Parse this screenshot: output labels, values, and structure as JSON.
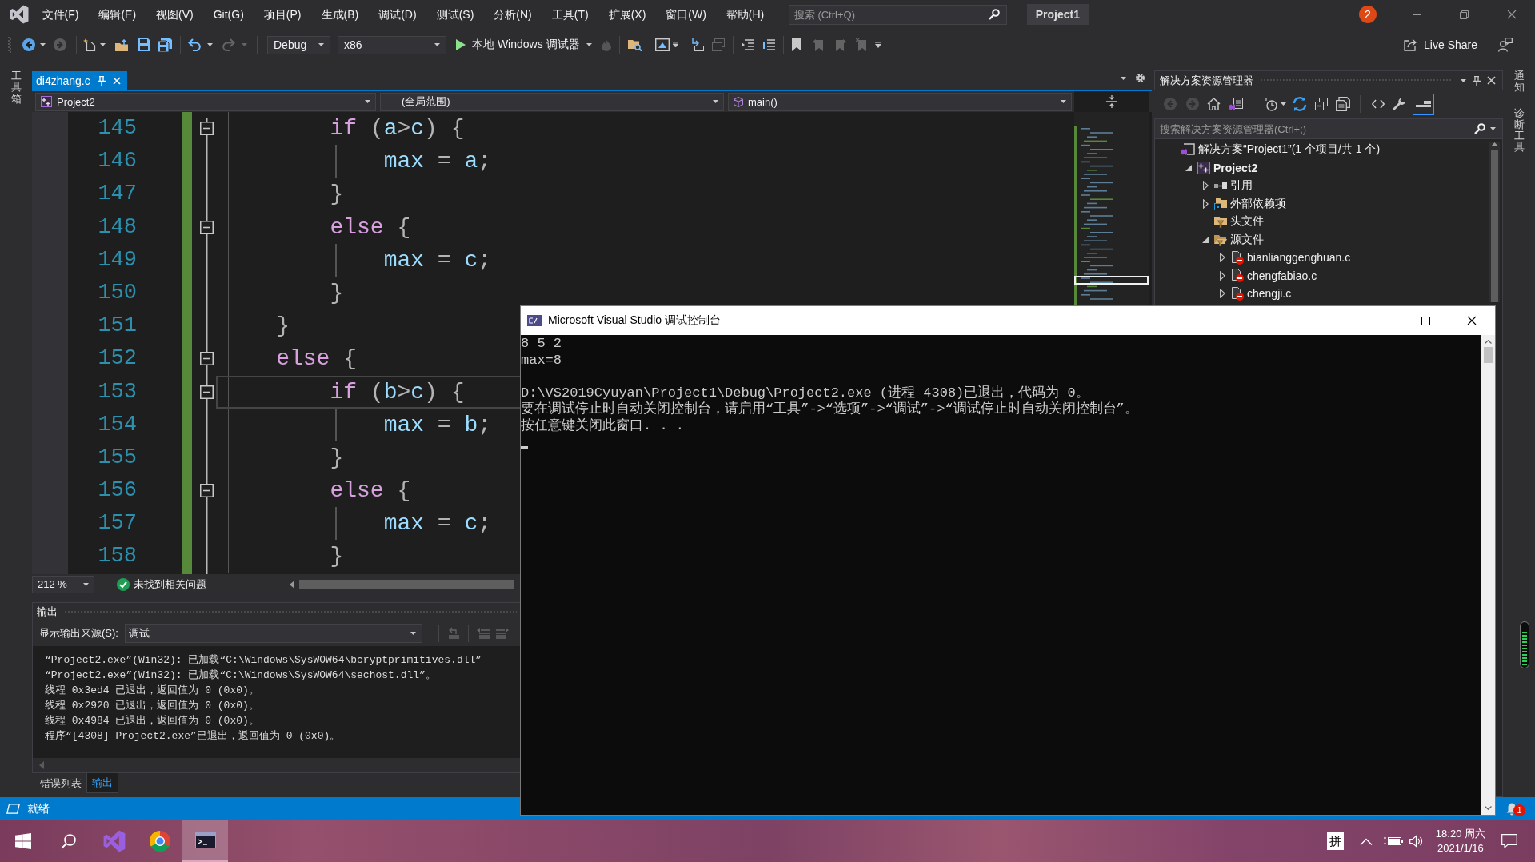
{
  "menu_bar": {
    "items": [
      "文件(F)",
      "编辑(E)",
      "视图(V)",
      "Git(G)",
      "项目(P)",
      "生成(B)",
      "调试(D)",
      "测试(S)",
      "分析(N)",
      "工具(T)",
      "扩展(X)",
      "窗口(W)",
      "帮助(H)"
    ],
    "search": {
      "placeholder": "搜索 (Ctrl+Q)"
    },
    "solution_name": "Project1",
    "notification_count": "2"
  },
  "toolbar": {
    "configuration": "Debug",
    "platform": "x86",
    "run_target": "本地 Windows 调试器",
    "live_share": "Live Share"
  },
  "left_strip": {
    "tabs": [
      "工具箱"
    ]
  },
  "document_tabs": [
    {
      "label": "di4zhang.c",
      "selected": true
    }
  ],
  "navigation_bar": {
    "project": "Project2",
    "scope": "(全局范围)",
    "member": "main()"
  },
  "editor": {
    "lines": [
      {
        "number": "145",
        "tokens": [
          {
            "kind": "keyword",
            "text": "        if"
          },
          {
            "kind": "punct",
            "text": " ("
          },
          {
            "kind": "ident",
            "text": "a"
          },
          {
            "kind": "punct",
            "text": ">"
          },
          {
            "kind": "ident",
            "text": "c"
          },
          {
            "kind": "punct",
            "text": ") {"
          }
        ],
        "collapsible": true,
        "current": false
      },
      {
        "number": "146",
        "tokens": [
          {
            "kind": "ident",
            "text": "            max"
          },
          {
            "kind": "punct",
            "text": " = "
          },
          {
            "kind": "ident",
            "text": "a"
          },
          {
            "kind": "punct",
            "text": ";"
          }
        ],
        "collapsible": false,
        "current": false
      },
      {
        "number": "147",
        "tokens": [
          {
            "kind": "punct",
            "text": "        }"
          }
        ],
        "collapsible": false,
        "current": false
      },
      {
        "number": "148",
        "tokens": [
          {
            "kind": "keyword",
            "text": "        else"
          },
          {
            "kind": "punct",
            "text": " {"
          }
        ],
        "collapsible": true,
        "current": false
      },
      {
        "number": "149",
        "tokens": [
          {
            "kind": "ident",
            "text": "            max"
          },
          {
            "kind": "punct",
            "text": " = "
          },
          {
            "kind": "ident",
            "text": "c"
          },
          {
            "kind": "punct",
            "text": ";"
          }
        ],
        "collapsible": false,
        "current": false
      },
      {
        "number": "150",
        "tokens": [
          {
            "kind": "punct",
            "text": "        }"
          }
        ],
        "collapsible": false,
        "current": false
      },
      {
        "number": "151",
        "tokens": [
          {
            "kind": "punct",
            "text": "    }"
          }
        ],
        "collapsible": false,
        "current": false
      },
      {
        "number": "152",
        "tokens": [
          {
            "kind": "keyword",
            "text": "    else"
          },
          {
            "kind": "punct",
            "text": " {"
          }
        ],
        "collapsible": true,
        "current": false
      },
      {
        "number": "153",
        "tokens": [
          {
            "kind": "keyword",
            "text": "        if"
          },
          {
            "kind": "punct",
            "text": " ("
          },
          {
            "kind": "ident",
            "text": "b"
          },
          {
            "kind": "punct",
            "text": ">"
          },
          {
            "kind": "ident",
            "text": "c"
          },
          {
            "kind": "punct",
            "text": ") {"
          }
        ],
        "collapsible": true,
        "current": true
      },
      {
        "number": "154",
        "tokens": [
          {
            "kind": "ident",
            "text": "            max"
          },
          {
            "kind": "punct",
            "text": " = "
          },
          {
            "kind": "ident",
            "text": "b"
          },
          {
            "kind": "punct",
            "text": ";"
          }
        ],
        "collapsible": false,
        "current": false
      },
      {
        "number": "155",
        "tokens": [
          {
            "kind": "punct",
            "text": "        }"
          }
        ],
        "collapsible": false,
        "current": false
      },
      {
        "number": "156",
        "tokens": [
          {
            "kind": "keyword",
            "text": "        else"
          },
          {
            "kind": "punct",
            "text": " {"
          }
        ],
        "collapsible": true,
        "current": false
      },
      {
        "number": "157",
        "tokens": [
          {
            "kind": "ident",
            "text": "            max"
          },
          {
            "kind": "punct",
            "text": " = "
          },
          {
            "kind": "ident",
            "text": "c"
          },
          {
            "kind": "punct",
            "text": ";"
          }
        ],
        "collapsible": false,
        "current": false
      },
      {
        "number": "158",
        "tokens": [
          {
            "kind": "punct",
            "text": "        }"
          }
        ],
        "collapsible": false,
        "current": false
      }
    ]
  },
  "editor_status": {
    "zoom": "212 %",
    "issues": "未找到相关问题"
  },
  "output_panel": {
    "title": "输出",
    "source_label": "显示输出来源(S):",
    "source": "调试",
    "lines": [
      "“Project2.exe”(Win32): 已加载“C:\\Windows\\SysWOW64\\bcryptprimitives.dll”",
      "“Project2.exe”(Win32): 已加载“C:\\Windows\\SysWOW64\\sechost.dll”。",
      "线程 0x3ed4 已退出，返回值为 0 (0x0)。",
      "线程 0x2920 已退出，返回值为 0 (0x0)。",
      "线程 0x4984 已退出，返回值为 0 (0x0)。",
      "程序“[4308] Project2.exe”已退出，返回值为 0 (0x0)。"
    ]
  },
  "bottom_tabs": [
    {
      "label": "错误列表",
      "selected": false
    },
    {
      "label": "输出",
      "selected": true
    }
  ],
  "solution_explorer": {
    "title": "解决方案资源管理器",
    "toolbar_toggle": {
      "on": true
    },
    "search": {
      "placeholder": "搜索解决方案资源管理器(Ctrl+;)"
    },
    "tree": [
      {
        "label": "解决方案“Project1”(1 个项目/共 1 个)",
        "kind": "solution",
        "children": [
          {
            "label": "Project2",
            "kind": "project",
            "expanded": true,
            "children": [
              {
                "label": "引用",
                "kind": "references",
                "expanded": false
              },
              {
                "label": "外部依赖项",
                "kind": "dependencies",
                "expanded": false
              },
              {
                "label": "头文件",
                "kind": "filter"
              },
              {
                "label": "源文件",
                "kind": "filter",
                "expanded": true,
                "children": [
                  {
                    "label": "bianlianggenghuan.c",
                    "kind": "c-file",
                    "expanded": false
                  },
                  {
                    "label": "chengfabiao.c",
                    "kind": "c-file",
                    "expanded": false
                  },
                  {
                    "label": "chengji.c",
                    "kind": "c-file",
                    "expanded": false
                  }
                ]
              }
            ]
          }
        ]
      }
    ]
  },
  "right_strip": {
    "tabs": [
      "通知",
      "诊断工具"
    ],
    "meter": {
      "level": 0.8
    }
  },
  "console": {
    "title": "Microsoft Visual Studio 调试控制台",
    "blocks": [
      [
        "8 5 2",
        "max=8"
      ],
      [
        "D:\\VS2019Cyuyan\\Project1\\Debug\\Project2.exe (进程 4308)已退出，代码为 0。",
        "要在调试停止时自动关闭控制台，请启用“工具”->“选项”->“调试”->“调试停止时自动关闭控制台”。",
        "按任意键关闭此窗口. . ."
      ]
    ]
  },
  "status_bar": {
    "text": "就绪",
    "notification_count": "1"
  },
  "taskbar": {
    "apps": [
      {
        "kind": "ribbon",
        "selected": false
      },
      {
        "kind": "ring",
        "selected": false
      },
      {
        "kind": "terminal",
        "selected": true
      }
    ],
    "ime": "拼",
    "time": "18:20 周六",
    "date": "2021/1/16"
  }
}
